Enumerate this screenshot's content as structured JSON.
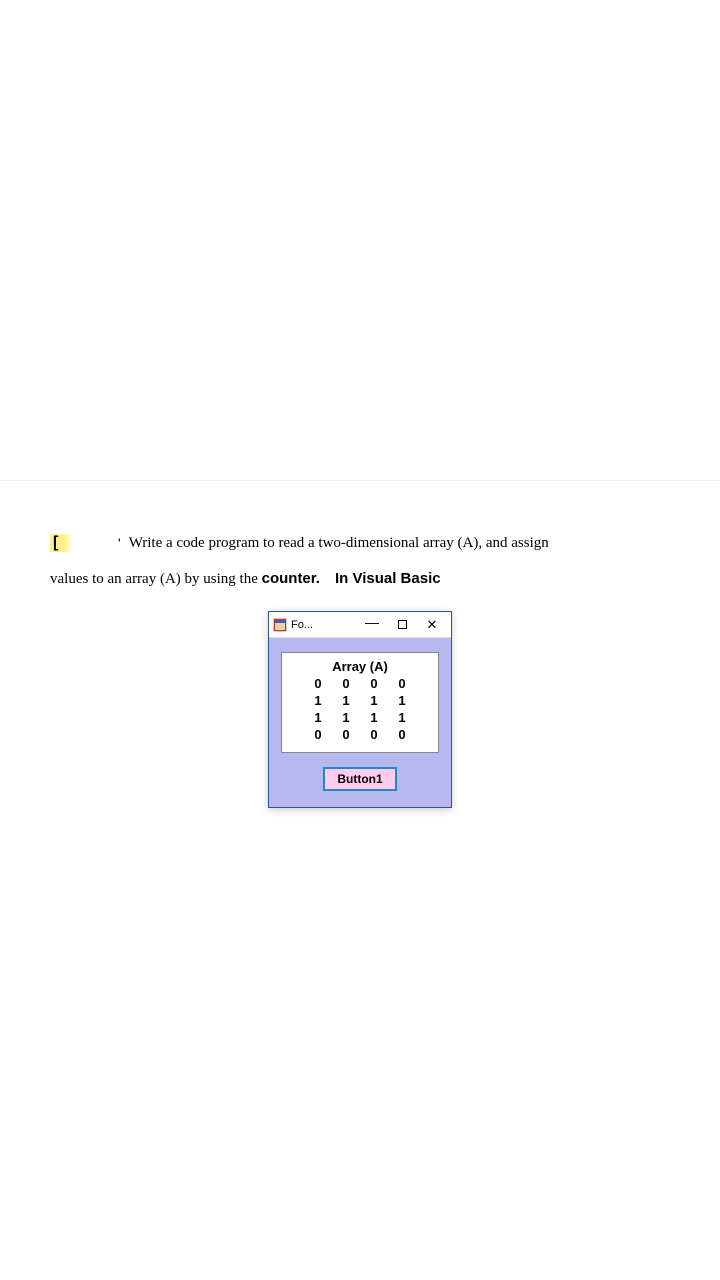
{
  "question": {
    "line1_prefix": "Write a code program to read a two-dimensional array (A), and assign",
    "line2_prefix": "values to an array (A) by using the ",
    "counter_word": "counter.",
    "vb_label": "In Visual Basic"
  },
  "form": {
    "title": "Fo...",
    "array_title": "Array (A)",
    "array_data": {
      "rows": [
        [
          "0",
          "0",
          "0",
          "0"
        ],
        [
          "1",
          "1",
          "1",
          "1"
        ],
        [
          "1",
          "1",
          "1",
          "1"
        ],
        [
          "0",
          "0",
          "0",
          "0"
        ]
      ]
    },
    "button_label": "Button1"
  }
}
